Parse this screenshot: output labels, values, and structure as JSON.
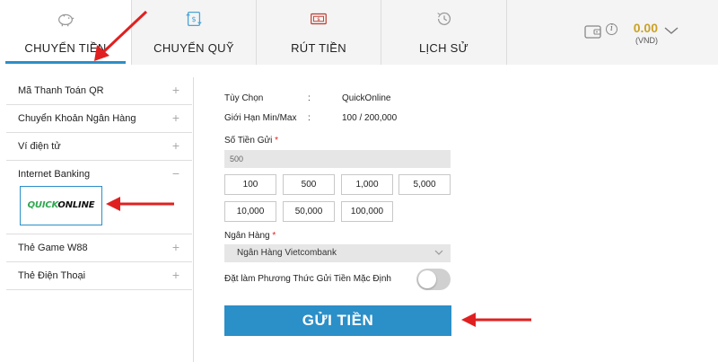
{
  "tabs": [
    {
      "label": "CHUYỂN TIỀN",
      "icon": "piggy-bank-icon",
      "active": true
    },
    {
      "label": "CHUYỂN QUỸ",
      "icon": "transfer-money-icon",
      "active": false
    },
    {
      "label": "RÚT TIỀN",
      "icon": "withdraw-cash-icon",
      "active": false
    },
    {
      "label": "LỊCH SỬ",
      "icon": "history-clock-icon",
      "active": false
    }
  ],
  "wallet": {
    "amount": "0.00",
    "currency": "(VND)",
    "info_symbol": "i"
  },
  "sidebar": {
    "items": [
      {
        "label": "Mã Thanh Toán QR",
        "toggle": "+"
      },
      {
        "label": "Chuyển Khoản Ngân Hàng",
        "toggle": "+"
      },
      {
        "label": "Ví điện tử",
        "toggle": "+"
      },
      {
        "label": "Internet Banking",
        "toggle": "−"
      },
      {
        "label": "Thẻ Game W88",
        "toggle": "+"
      },
      {
        "label": "Thẻ Điện Thoại",
        "toggle": "+"
      }
    ],
    "selected_method": {
      "logo_part1": "QUICK",
      "logo_part2": "ONLINE"
    }
  },
  "form": {
    "option_label": "Tùy Chọn",
    "option_value": "QuickOnline",
    "limit_label": "Giới Hạn Min/Max",
    "limit_value": "100 / 200,000",
    "separator": ":",
    "amount_label": "Số Tiền Gửi",
    "amount_value": "500",
    "quick_amounts": [
      "100",
      "500",
      "1,000",
      "5,000",
      "10,000",
      "50,000",
      "100,000"
    ],
    "bank_label": "Ngân Hàng",
    "bank_value": "Ngân Hàng Vietcombank",
    "required_mark": "*",
    "default_label": "Đặt làm Phương Thức Gửi Tiền Mặc Định",
    "default_enabled": false,
    "submit_label": "GỬI TIỀN"
  },
  "colors": {
    "accent": "#2b8fc8",
    "gold": "#c9a227",
    "arrow": "#e02020",
    "quick_green": "#2fa84f"
  }
}
